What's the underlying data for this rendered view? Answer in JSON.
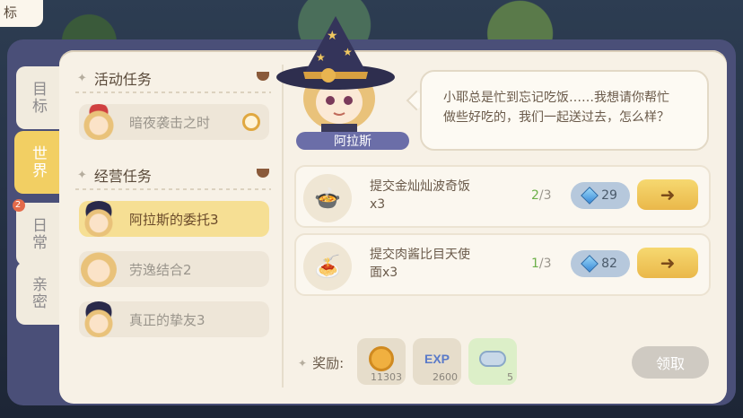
{
  "corner": {
    "label": "标"
  },
  "tabs": [
    {
      "label": "目标",
      "active": false,
      "badge": null
    },
    {
      "label": "世界",
      "active": true,
      "badge": null
    },
    {
      "label": "日常",
      "active": false,
      "badge": "2"
    },
    {
      "label": "亲密",
      "active": false,
      "badge": null
    }
  ],
  "sections": {
    "activity": {
      "title": "活动任务"
    },
    "business": {
      "title": "经营任务"
    }
  },
  "tasks": {
    "activity": [
      {
        "label": "暗夜袭击之时",
        "avatar": "blonde-santa-hat-avatar",
        "timer_icon": "clock-icon"
      }
    ],
    "business": [
      {
        "label": "阿拉斯的委托3",
        "avatar": "witch-hat-avatar",
        "active": true
      },
      {
        "label": "劳逸结合2",
        "avatar": "blonde-avatar",
        "active": false
      },
      {
        "label": "真正的挚友3",
        "avatar": "witch-hat-avatar",
        "active": false
      }
    ]
  },
  "character": {
    "name": "阿拉斯",
    "dialogue_line1": "小耶总是忙到忘记吃饭……我想请你帮忙",
    "dialogue_line2": "做些好吃的，我们一起送过去，怎么样？"
  },
  "quests": [
    {
      "desc_line1": "提交金灿灿波奇饭",
      "desc_line2": "x3",
      "have": "2",
      "need": "/3",
      "cost": "29",
      "food_icon": "rice-bowl-icon"
    },
    {
      "desc_line1": "提交肉酱比目天使",
      "desc_line2": "面x3",
      "have": "1",
      "need": "/3",
      "cost": "82",
      "food_icon": "pasta-plate-icon"
    }
  ],
  "rewards": {
    "label": "奖励:",
    "items": [
      {
        "icon": "coin-icon",
        "qty": "11303"
      },
      {
        "icon": "exp-icon",
        "text": "EXP",
        "qty": "2600"
      },
      {
        "icon": "cloud-icon",
        "qty": "5"
      }
    ],
    "claim_label": "领取"
  },
  "colors": {
    "panel": "#4a4f78",
    "paper": "#f7f1e6",
    "active_tab": "#f2cf63",
    "go_button": "#eab84a",
    "cost_pill": "#b6c8dc",
    "progress_have": "#6cb04a"
  }
}
